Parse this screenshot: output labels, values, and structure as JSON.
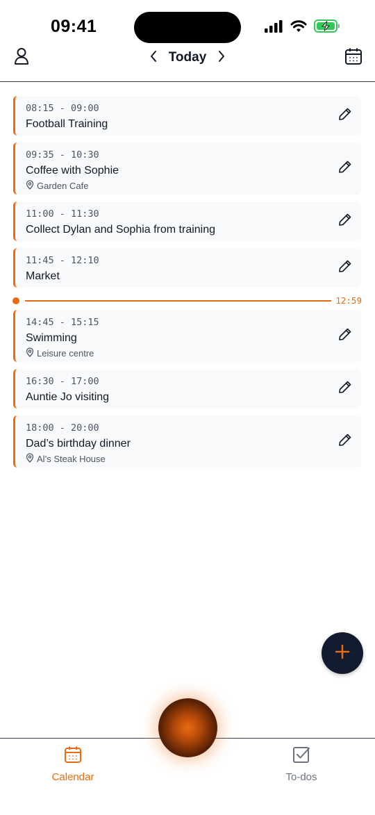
{
  "status_bar": {
    "time": "09:41"
  },
  "header": {
    "title": "Today"
  },
  "events": [
    {
      "time": "08:15 - 09:00",
      "title": "Football Training",
      "location": ""
    },
    {
      "time": "09:35 - 10:30",
      "title": "Coffee with Sophie",
      "location": "Garden Cafe"
    },
    {
      "time": "11:00 - 11:30",
      "title": "Collect Dylan and Sophia from training",
      "location": ""
    },
    {
      "time": "11:45 - 12:10",
      "title": "Market",
      "location": ""
    },
    {
      "time": "14:45 - 15:15",
      "title": "Swimming",
      "location": "Leisure centre"
    },
    {
      "time": "16:30 - 17:00",
      "title": "Auntie Jo visiting",
      "location": ""
    },
    {
      "time": "18:00 - 20:00",
      "title": "Dad’s birthday dinner",
      "location": "Al’s Steak House"
    }
  ],
  "now_indicator": {
    "time": "12:59"
  },
  "tabs": {
    "calendar": "Calendar",
    "todos": "To-dos",
    "active": "calendar"
  },
  "colors": {
    "accent": "#ea6b10",
    "fab": "#111a2e",
    "text": "#111827",
    "muted": "#6b7280"
  },
  "icons": {
    "profile": "user-icon",
    "calendar": "calendar-icon",
    "prev": "chevron-left-icon",
    "next": "chevron-right-icon",
    "edit": "pencil-icon",
    "location": "map-pin-icon",
    "add": "plus-icon",
    "todos": "checkbox-icon"
  }
}
